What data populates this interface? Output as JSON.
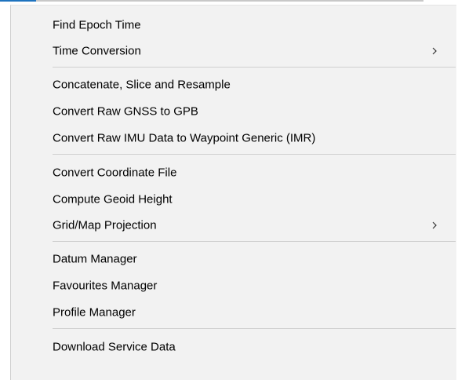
{
  "menu": {
    "groups": [
      [
        {
          "label": "Find Epoch Time",
          "submenu": false
        },
        {
          "label": "Time Conversion",
          "submenu": true,
          "icon": "chevron-right-icon"
        }
      ],
      [
        {
          "label": "Concatenate, Slice and Resample",
          "submenu": false
        },
        {
          "label": "Convert Raw GNSS to GPB",
          "submenu": false
        },
        {
          "label": "Convert Raw IMU Data to Waypoint Generic (IMR)",
          "submenu": false
        }
      ],
      [
        {
          "label": "Convert Coordinate File",
          "submenu": false
        },
        {
          "label": "Compute Geoid Height",
          "submenu": false
        },
        {
          "label": "Grid/Map Projection",
          "submenu": true,
          "icon": "chevron-right-icon"
        }
      ],
      [
        {
          "label": "Datum Manager",
          "submenu": false
        },
        {
          "label": "Favourites Manager",
          "submenu": false
        },
        {
          "label": "Profile Manager",
          "submenu": false
        }
      ],
      [
        {
          "label": "Download Service Data",
          "submenu": false
        }
      ]
    ]
  },
  "colors": {
    "menu_background": "#f2f2f2",
    "separator": "#cfcfcf",
    "text": "#000000",
    "accent": "#1e73be"
  }
}
